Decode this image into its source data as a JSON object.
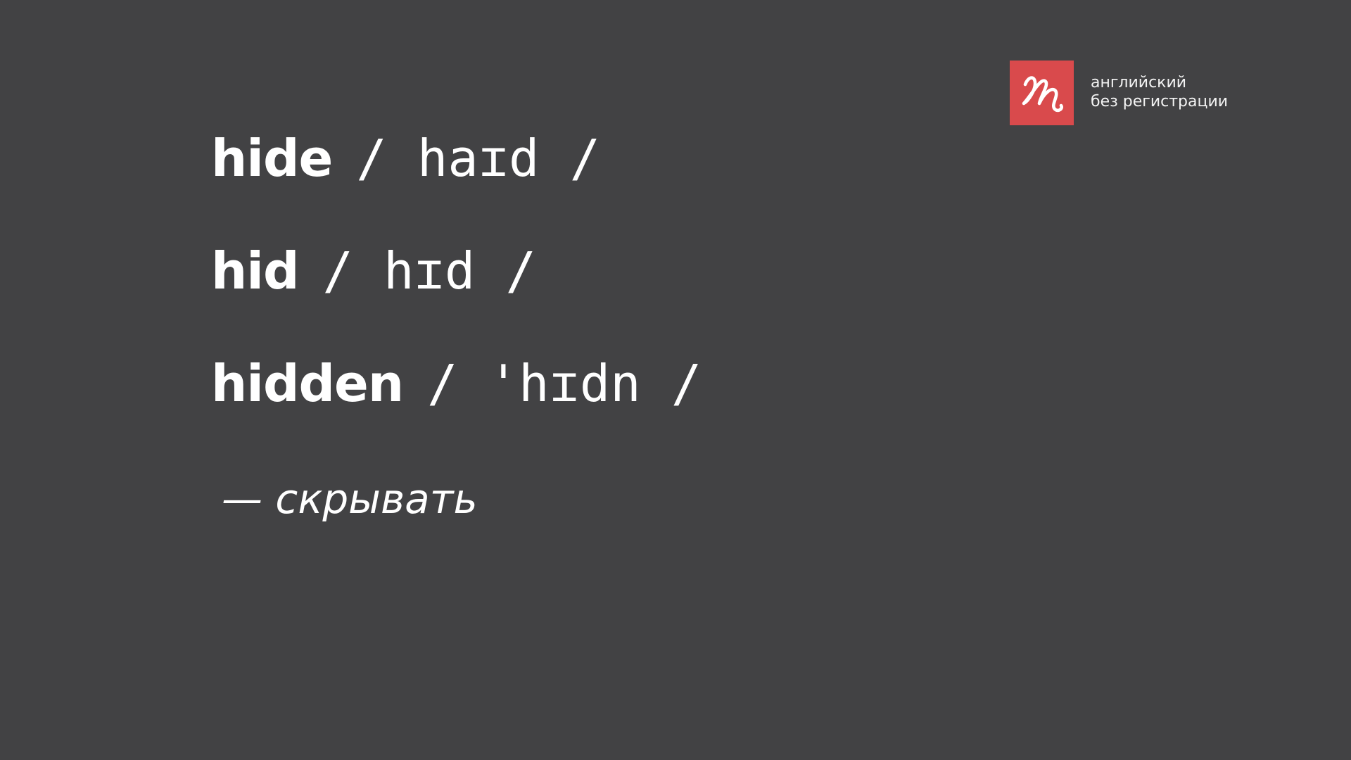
{
  "brand": {
    "logo_icon": "handwritten-squiggle-icon",
    "accent_color": "#d94a4c",
    "line1": "английский",
    "line2": "без регистрации"
  },
  "words": [
    {
      "word": "hide",
      "transcription": "/ haɪd /"
    },
    {
      "word": "hid",
      "transcription": "/ hɪd /"
    },
    {
      "word": "hidden",
      "transcription": "/ 'hɪdn /"
    }
  ],
  "translation": "— скрывать"
}
